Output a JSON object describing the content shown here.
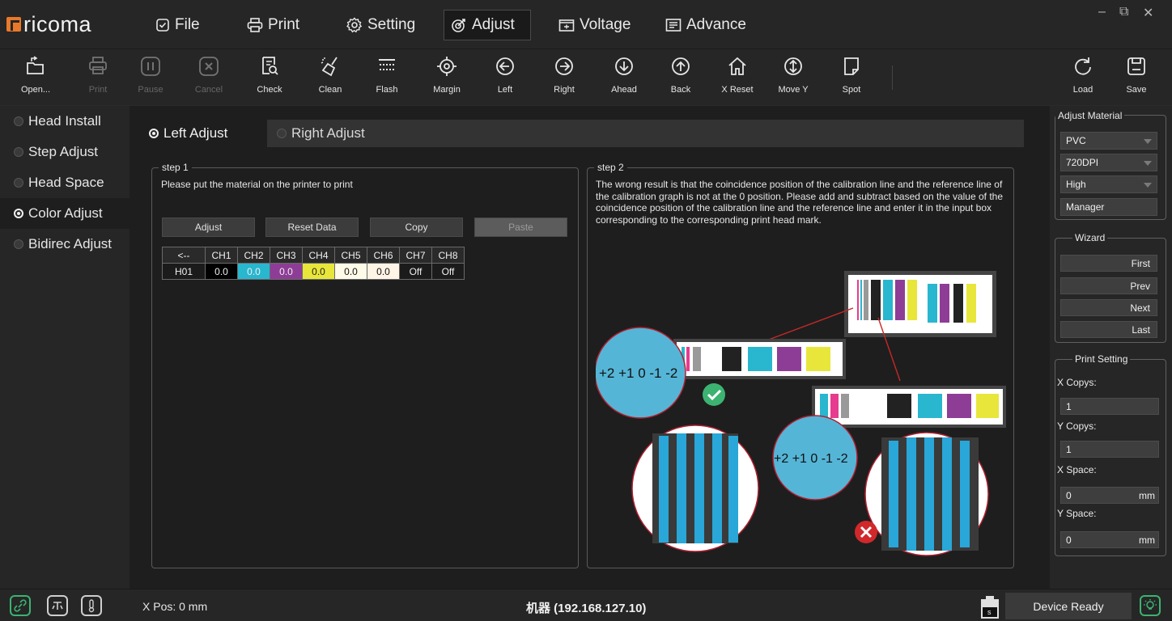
{
  "app": {
    "logo_text": "ricoma"
  },
  "menu": {
    "file": "File",
    "print": "Print",
    "setting": "Setting",
    "adjust": "Adjust",
    "voltage": "Voltage",
    "advance": "Advance"
  },
  "window_controls": {
    "minimize": "–",
    "restore": "⧉",
    "close": "✕"
  },
  "toolbar": {
    "open": "Open...",
    "print": "Print",
    "pause": "Pause",
    "cancel": "Cancel",
    "check": "Check",
    "clean": "Clean",
    "flash": "Flash",
    "margin": "Margin",
    "left": "Left",
    "right": "Right",
    "ahead": "Ahead",
    "back": "Back",
    "x_reset": "X Reset",
    "move_y": "Move Y",
    "spot": "Spot",
    "load": "Load",
    "save": "Save"
  },
  "sidenav": {
    "items": [
      {
        "label": "Head Install",
        "active": false
      },
      {
        "label": "Step Adjust",
        "active": false
      },
      {
        "label": "Head Space",
        "active": false
      },
      {
        "label": "Color Adjust",
        "active": true
      },
      {
        "label": "Bidirec Adjust",
        "active": false
      }
    ]
  },
  "tabs": {
    "left": "Left Adjust",
    "right": "Right Adjust",
    "active": "left"
  },
  "step1": {
    "title": "step 1",
    "instruction": "Please put the material on the printer to print",
    "buttons": {
      "adjust": "Adjust",
      "reset_data": "Reset Data",
      "copy": "Copy",
      "paste": "Paste"
    },
    "table": {
      "headers": [
        "<--",
        "CH1",
        "CH2",
        "CH3",
        "CH4",
        "CH5",
        "CH6",
        "CH7",
        "CH8"
      ],
      "row_label": "H01",
      "values": [
        "0.0",
        "0.0",
        "0.0",
        "0.0",
        "0.0",
        "0.0",
        "Off",
        "Off"
      ],
      "cell_colors": [
        "#000000",
        "#29b6cf",
        "#8e3d96",
        "#e8e63a",
        "#fffbe8",
        "#fff4e6",
        "#1b1b1b",
        "#1b1b1b"
      ]
    }
  },
  "step2": {
    "title": "step 2",
    "text": "The wrong result is that the coincidence position of the calibration line and the reference line of the calibration graph is not at the 0 position. Please add and subtract based on the value of the coincidence position of the calibration line and the reference line and enter it in the input box corresponding to the corresponding print head mark.",
    "diagram_scale": "+2 +1 0 -1 -2",
    "diagram_scale_num": "-2"
  },
  "right_panel": {
    "adjust_material": {
      "title": "Adjust Material",
      "material": "PVC",
      "resolution": "720DPI",
      "quality": "High",
      "manager": "Manager"
    },
    "wizard": {
      "title": "Wizard",
      "first": "First",
      "prev": "Prev",
      "next": "Next",
      "last": "Last"
    },
    "print_setting": {
      "title": "Print Setting",
      "x_copys_label": "X Copys:",
      "x_copys": "1",
      "y_copys_label": "Y Copys:",
      "y_copys": "1",
      "x_space_label": "X Space:",
      "x_space": "0",
      "y_space_label": "Y Space:",
      "y_space": "0",
      "unit": "mm"
    }
  },
  "status": {
    "x_pos": "X Pos: 0 mm",
    "machine": "机器  (192.168.127.10)",
    "device_ready": "Device Ready",
    "battery_mark": "s"
  },
  "colors": {
    "accent_orange": "#e8792b",
    "cyan": "#29b6cf",
    "magenta": "#8e3d96",
    "yellow": "#e8e63a",
    "ok_green": "#3cb371",
    "error_red": "#d0282b"
  }
}
